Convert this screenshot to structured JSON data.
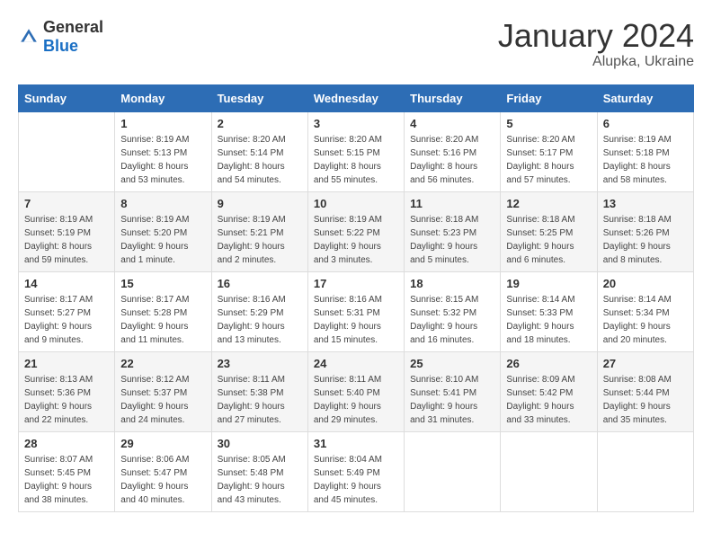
{
  "logo": {
    "text_general": "General",
    "text_blue": "Blue"
  },
  "header": {
    "month": "January 2024",
    "location": "Alupka, Ukraine"
  },
  "days_of_week": [
    "Sunday",
    "Monday",
    "Tuesday",
    "Wednesday",
    "Thursday",
    "Friday",
    "Saturday"
  ],
  "weeks": [
    [
      {
        "day": "",
        "sunrise": "",
        "sunset": "",
        "daylight": ""
      },
      {
        "day": "1",
        "sunrise": "Sunrise: 8:19 AM",
        "sunset": "Sunset: 5:13 PM",
        "daylight": "Daylight: 8 hours and 53 minutes."
      },
      {
        "day": "2",
        "sunrise": "Sunrise: 8:20 AM",
        "sunset": "Sunset: 5:14 PM",
        "daylight": "Daylight: 8 hours and 54 minutes."
      },
      {
        "day": "3",
        "sunrise": "Sunrise: 8:20 AM",
        "sunset": "Sunset: 5:15 PM",
        "daylight": "Daylight: 8 hours and 55 minutes."
      },
      {
        "day": "4",
        "sunrise": "Sunrise: 8:20 AM",
        "sunset": "Sunset: 5:16 PM",
        "daylight": "Daylight: 8 hours and 56 minutes."
      },
      {
        "day": "5",
        "sunrise": "Sunrise: 8:20 AM",
        "sunset": "Sunset: 5:17 PM",
        "daylight": "Daylight: 8 hours and 57 minutes."
      },
      {
        "day": "6",
        "sunrise": "Sunrise: 8:19 AM",
        "sunset": "Sunset: 5:18 PM",
        "daylight": "Daylight: 8 hours and 58 minutes."
      }
    ],
    [
      {
        "day": "7",
        "sunrise": "Sunrise: 8:19 AM",
        "sunset": "Sunset: 5:19 PM",
        "daylight": "Daylight: 8 hours and 59 minutes."
      },
      {
        "day": "8",
        "sunrise": "Sunrise: 8:19 AM",
        "sunset": "Sunset: 5:20 PM",
        "daylight": "Daylight: 9 hours and 1 minute."
      },
      {
        "day": "9",
        "sunrise": "Sunrise: 8:19 AM",
        "sunset": "Sunset: 5:21 PM",
        "daylight": "Daylight: 9 hours and 2 minutes."
      },
      {
        "day": "10",
        "sunrise": "Sunrise: 8:19 AM",
        "sunset": "Sunset: 5:22 PM",
        "daylight": "Daylight: 9 hours and 3 minutes."
      },
      {
        "day": "11",
        "sunrise": "Sunrise: 8:18 AM",
        "sunset": "Sunset: 5:23 PM",
        "daylight": "Daylight: 9 hours and 5 minutes."
      },
      {
        "day": "12",
        "sunrise": "Sunrise: 8:18 AM",
        "sunset": "Sunset: 5:25 PM",
        "daylight": "Daylight: 9 hours and 6 minutes."
      },
      {
        "day": "13",
        "sunrise": "Sunrise: 8:18 AM",
        "sunset": "Sunset: 5:26 PM",
        "daylight": "Daylight: 9 hours and 8 minutes."
      }
    ],
    [
      {
        "day": "14",
        "sunrise": "Sunrise: 8:17 AM",
        "sunset": "Sunset: 5:27 PM",
        "daylight": "Daylight: 9 hours and 9 minutes."
      },
      {
        "day": "15",
        "sunrise": "Sunrise: 8:17 AM",
        "sunset": "Sunset: 5:28 PM",
        "daylight": "Daylight: 9 hours and 11 minutes."
      },
      {
        "day": "16",
        "sunrise": "Sunrise: 8:16 AM",
        "sunset": "Sunset: 5:29 PM",
        "daylight": "Daylight: 9 hours and 13 minutes."
      },
      {
        "day": "17",
        "sunrise": "Sunrise: 8:16 AM",
        "sunset": "Sunset: 5:31 PM",
        "daylight": "Daylight: 9 hours and 15 minutes."
      },
      {
        "day": "18",
        "sunrise": "Sunrise: 8:15 AM",
        "sunset": "Sunset: 5:32 PM",
        "daylight": "Daylight: 9 hours and 16 minutes."
      },
      {
        "day": "19",
        "sunrise": "Sunrise: 8:14 AM",
        "sunset": "Sunset: 5:33 PM",
        "daylight": "Daylight: 9 hours and 18 minutes."
      },
      {
        "day": "20",
        "sunrise": "Sunrise: 8:14 AM",
        "sunset": "Sunset: 5:34 PM",
        "daylight": "Daylight: 9 hours and 20 minutes."
      }
    ],
    [
      {
        "day": "21",
        "sunrise": "Sunrise: 8:13 AM",
        "sunset": "Sunset: 5:36 PM",
        "daylight": "Daylight: 9 hours and 22 minutes."
      },
      {
        "day": "22",
        "sunrise": "Sunrise: 8:12 AM",
        "sunset": "Sunset: 5:37 PM",
        "daylight": "Daylight: 9 hours and 24 minutes."
      },
      {
        "day": "23",
        "sunrise": "Sunrise: 8:11 AM",
        "sunset": "Sunset: 5:38 PM",
        "daylight": "Daylight: 9 hours and 27 minutes."
      },
      {
        "day": "24",
        "sunrise": "Sunrise: 8:11 AM",
        "sunset": "Sunset: 5:40 PM",
        "daylight": "Daylight: 9 hours and 29 minutes."
      },
      {
        "day": "25",
        "sunrise": "Sunrise: 8:10 AM",
        "sunset": "Sunset: 5:41 PM",
        "daylight": "Daylight: 9 hours and 31 minutes."
      },
      {
        "day": "26",
        "sunrise": "Sunrise: 8:09 AM",
        "sunset": "Sunset: 5:42 PM",
        "daylight": "Daylight: 9 hours and 33 minutes."
      },
      {
        "day": "27",
        "sunrise": "Sunrise: 8:08 AM",
        "sunset": "Sunset: 5:44 PM",
        "daylight": "Daylight: 9 hours and 35 minutes."
      }
    ],
    [
      {
        "day": "28",
        "sunrise": "Sunrise: 8:07 AM",
        "sunset": "Sunset: 5:45 PM",
        "daylight": "Daylight: 9 hours and 38 minutes."
      },
      {
        "day": "29",
        "sunrise": "Sunrise: 8:06 AM",
        "sunset": "Sunset: 5:47 PM",
        "daylight": "Daylight: 9 hours and 40 minutes."
      },
      {
        "day": "30",
        "sunrise": "Sunrise: 8:05 AM",
        "sunset": "Sunset: 5:48 PM",
        "daylight": "Daylight: 9 hours and 43 minutes."
      },
      {
        "day": "31",
        "sunrise": "Sunrise: 8:04 AM",
        "sunset": "Sunset: 5:49 PM",
        "daylight": "Daylight: 9 hours and 45 minutes."
      },
      {
        "day": "",
        "sunrise": "",
        "sunset": "",
        "daylight": ""
      },
      {
        "day": "",
        "sunrise": "",
        "sunset": "",
        "daylight": ""
      },
      {
        "day": "",
        "sunrise": "",
        "sunset": "",
        "daylight": ""
      }
    ]
  ]
}
